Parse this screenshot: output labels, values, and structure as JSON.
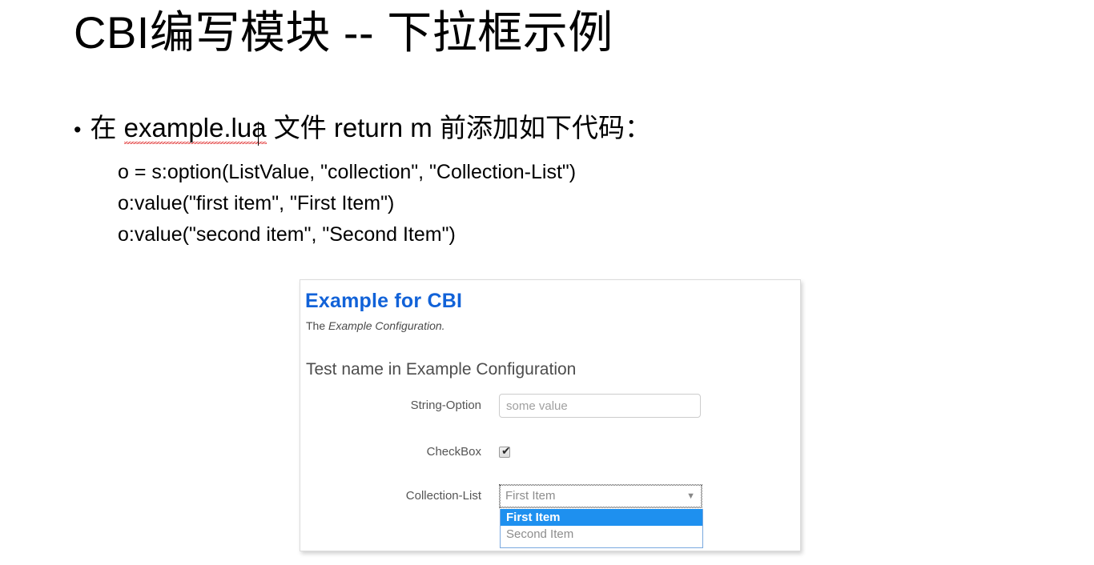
{
  "slide": {
    "title": "CBI编写模块 -- 下拉框示例",
    "bullet": {
      "marker": "•",
      "prefix": "在 ",
      "spell_error_word": "example.lua",
      "suffix": " 文件 return m 前添加如下代码："
    },
    "code_lines": [
      "o = s:option(ListValue, \"collection\", \"Collection-List\")",
      "o:value(\"first item\", \"First Item\")",
      "o:value(\"second item\", \"Second Item\")"
    ]
  },
  "cbi_panel": {
    "heading": "Example for CBI",
    "subtitle_prefix": "The ",
    "subtitle_emphasis": "Example Configuration.",
    "section_title": "Test name in Example Configuration",
    "fields": {
      "string_option": {
        "label": "String-Option",
        "placeholder": "some value",
        "value": ""
      },
      "checkbox": {
        "label": "CheckBox",
        "checked": true,
        "tick_glyph": "✔"
      },
      "collection_list": {
        "label": "Collection-List",
        "selected_value": "First Item",
        "arrow_glyph": "▼",
        "expanded": true,
        "options": [
          {
            "label": "First Item",
            "selected": true
          },
          {
            "label": "Second Item",
            "selected": false
          }
        ]
      }
    }
  },
  "colors": {
    "heading_blue": "#1162d8",
    "select_highlight": "#1e90ef",
    "spell_error_red": "#e03030",
    "body_text": "#000000",
    "label_grey": "#555555",
    "placeholder_grey": "#a0a0a0"
  }
}
